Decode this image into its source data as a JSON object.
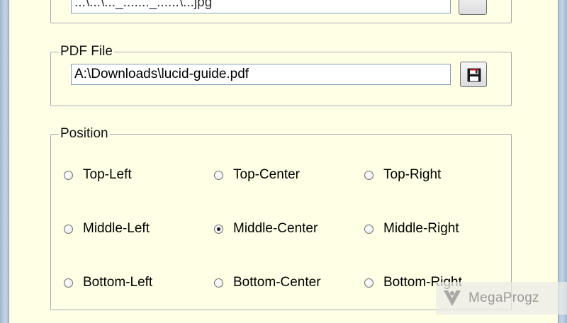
{
  "top_group": {
    "partial_path_value": "...\\...\\..._......._......\\...jpg"
  },
  "pdf_file": {
    "legend": "PDF File",
    "path_value": "A:\\Downloads\\lucid-guide.pdf"
  },
  "position": {
    "legend": "Position",
    "options": [
      {
        "label": "Top-Left",
        "selected": false
      },
      {
        "label": "Top-Center",
        "selected": false
      },
      {
        "label": "Top-Right",
        "selected": false
      },
      {
        "label": "Middle-Left",
        "selected": false
      },
      {
        "label": "Middle-Center",
        "selected": true
      },
      {
        "label": "Middle-Right",
        "selected": false
      },
      {
        "label": "Bottom-Left",
        "selected": false
      },
      {
        "label": "Bottom-Center",
        "selected": false
      },
      {
        "label": "Bottom-Right",
        "selected": false
      }
    ]
  },
  "watermark": {
    "text": "MegaProgz"
  },
  "colors": {
    "panel_background": "#ffffe6",
    "window_frame": "#b7c9dd"
  },
  "icons": {
    "save": "floppy-disk-icon",
    "watermark_logo": "megaprogz-logo-icon"
  }
}
